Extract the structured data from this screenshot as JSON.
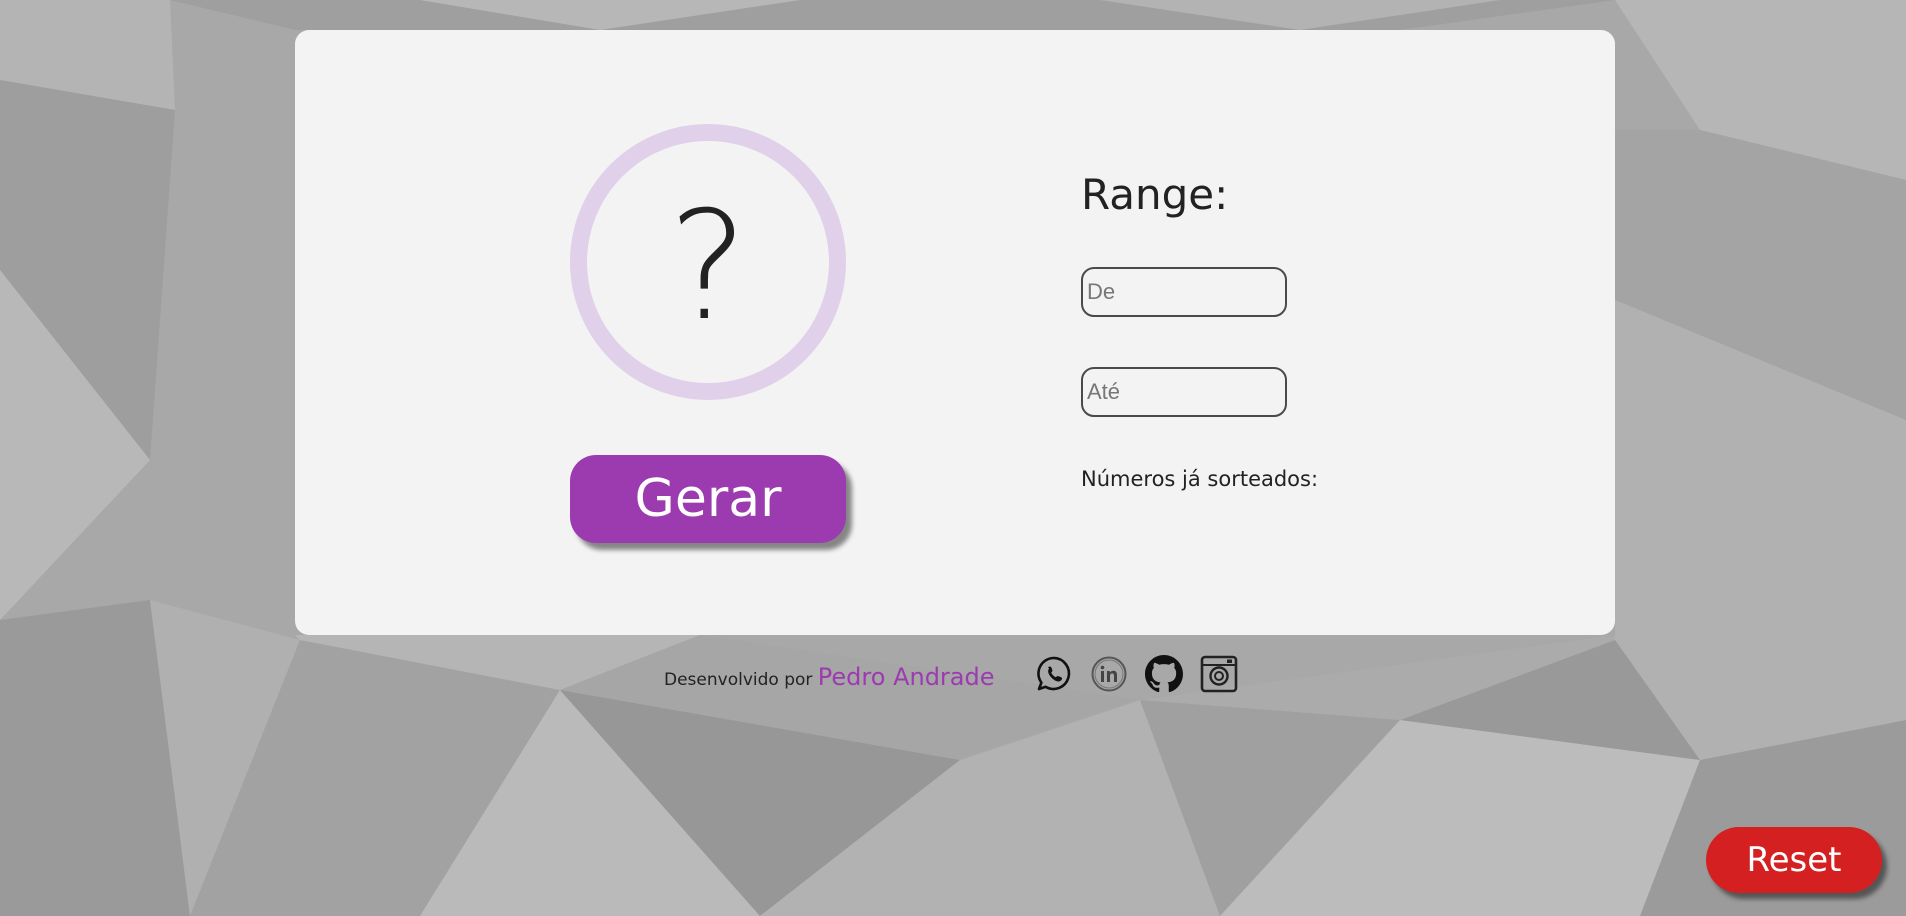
{
  "draw": {
    "result_symbol": "?",
    "generate_label": "Gerar"
  },
  "range": {
    "label": "Range:",
    "from_placeholder": "De",
    "to_placeholder": "Até",
    "from_value": "",
    "to_value": ""
  },
  "history": {
    "label": "Números já sorteados:"
  },
  "footer": {
    "prefix": "Desenvolvido por",
    "author": "Pedro Andrade",
    "social_icons": [
      "whatsapp-icon",
      "linkedin-icon",
      "github-icon",
      "instagram-icon"
    ]
  },
  "reset_label": "Reset",
  "colors": {
    "accent": "#9c3bb0",
    "circle_ring": "#e1d0ea",
    "reset": "#d42020",
    "card": "#f3f3f3",
    "background": "#a9a9a9"
  }
}
